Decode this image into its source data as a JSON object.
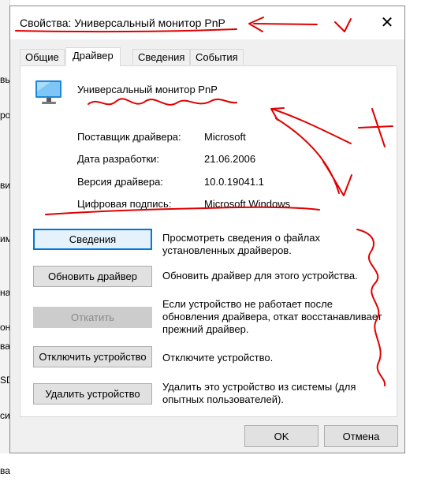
{
  "background_fragments": [
    "вы",
    "ро",
    "ви",
    "им",
    "на",
    "он",
    "ва",
    "SD",
    "си",
    "ва"
  ],
  "dialog": {
    "title": "Свойства: Универсальный монитор PnP",
    "close_glyph": "✕"
  },
  "tabs": [
    {
      "label": "Общие",
      "active": false
    },
    {
      "label": "Драйвер",
      "active": true
    },
    {
      "label": "Сведения",
      "active": false
    },
    {
      "label": "События",
      "active": false
    }
  ],
  "device": {
    "name": "Универсальный монитор PnP",
    "icon": "monitor-icon"
  },
  "info": [
    {
      "label": "Поставщик драйвера:",
      "value": "Microsoft"
    },
    {
      "label": "Дата разработки:",
      "value": "21.06.2006"
    },
    {
      "label": "Версия драйвера:",
      "value": "10.0.19041.1"
    },
    {
      "label": "Цифровая подпись:",
      "value": "Microsoft Windows"
    }
  ],
  "actions": [
    {
      "button": "Сведения",
      "description": "Просмотреть сведения о файлах установленных драйверов.",
      "enabled": true
    },
    {
      "button": "Обновить драйвер",
      "description": "Обновить драйвер для этого устройства.",
      "enabled": true
    },
    {
      "button": "Откатить",
      "description": "Если устройство не работает после обновления драйвера, откат восстанавливает прежний драйвер.",
      "enabled": false
    },
    {
      "button": "Отключить устройство",
      "description": "Отключите устройство.",
      "enabled": true
    },
    {
      "button": "Удалить устройство",
      "description": "Удалить это устройство из системы (для опытных пользователей).",
      "enabled": true
    }
  ],
  "footer": {
    "ok_label": "OK",
    "cancel_label": "Отмена"
  },
  "colors": {
    "annotation": "#e00000",
    "focus_border": "#0078d7",
    "dialog_bg": "#f0f0f0"
  }
}
